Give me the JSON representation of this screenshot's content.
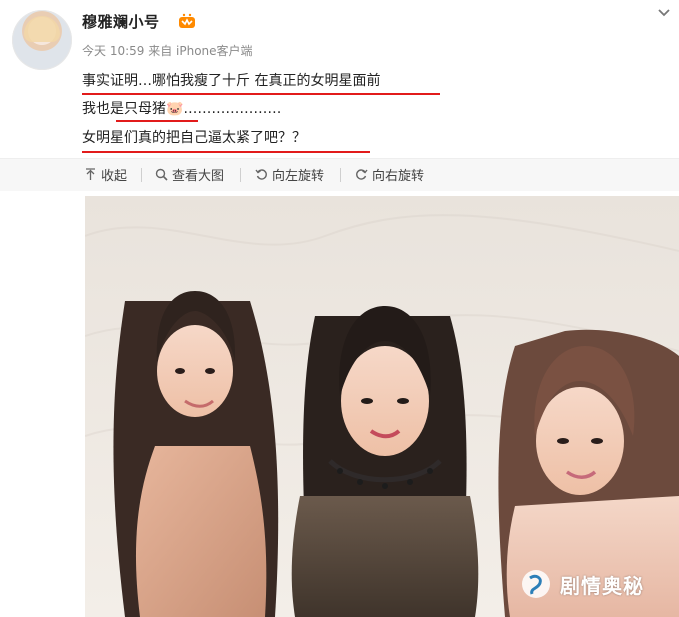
{
  "post": {
    "username": "穆雅斓小号",
    "meta": "今天 10:59 来自 iPhone客户端",
    "lines": [
      "事实证明…哪怕我瘦了十斤 在真正的女明星面前",
      "我也是只母猪🐷…………………",
      "女明星们真的把自己逼太紧了吧？？"
    ]
  },
  "toolbar": {
    "collapse": "收起",
    "view_large": "查看大图",
    "rotate_left": "向左旋转",
    "rotate_right": "向右旋转"
  },
  "watermark": {
    "text": "剧情奥秘"
  },
  "icons": {
    "vip": "vip-crown-icon",
    "chevron": "chevron-down-icon",
    "collapse": "collapse-up-icon",
    "search": "search-icon",
    "rotate_left": "rotate-left-icon",
    "rotate_right": "rotate-right-icon"
  },
  "colors": {
    "underline": "#e21b1b",
    "username": "#222222",
    "meta": "#8a8a8a",
    "toolbar_bg": "#f7f7f7"
  }
}
